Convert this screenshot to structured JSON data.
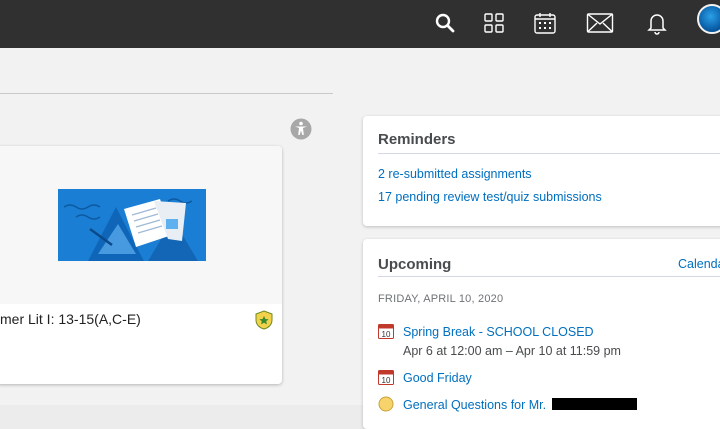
{
  "topbar": {
    "icons": [
      "search-icon",
      "grid-icon",
      "calendar-icon",
      "mail-icon",
      "bell-icon",
      "avatar"
    ]
  },
  "course": {
    "title": "mer Lit I: 13-15(A,C-E)"
  },
  "reminders": {
    "title": "Reminders",
    "items": [
      "2 re-submitted assignments",
      "17 pending review test/quiz submissions"
    ]
  },
  "upcoming": {
    "title": "Upcoming",
    "calendar_link": "Calenda",
    "date_header": "FRIDAY, APRIL 10, 2020",
    "events": [
      {
        "title": "Spring Break - SCHOOL CLOSED",
        "time": "Apr 6 at 12:00 am – Apr 10 at 11:59 pm",
        "icon_day": "10"
      },
      {
        "title": "Good Friday",
        "time": "",
        "icon_day": "10"
      },
      {
        "title": "General Questions for Mr.",
        "time": ""
      }
    ]
  }
}
